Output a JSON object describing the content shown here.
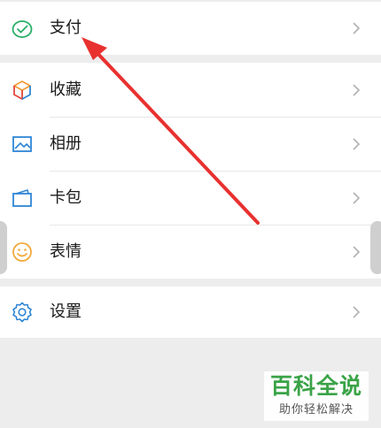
{
  "menu": {
    "pay": {
      "label": "支付",
      "icon": "wechat-pay-icon",
      "color": "#2aae67"
    },
    "items": [
      {
        "label": "收藏",
        "icon": "favorites-cube-icon"
      },
      {
        "label": "相册",
        "icon": "album-picture-icon",
        "color": "#2f86d6"
      },
      {
        "label": "卡包",
        "icon": "card-wallet-icon",
        "color": "#2f86d6"
      },
      {
        "label": "表情",
        "icon": "smiley-emoji-icon",
        "color": "#f2a93b"
      }
    ],
    "settings": {
      "label": "设置",
      "icon": "gear-settings-icon",
      "color": "#2f86d6"
    }
  },
  "watermark": {
    "main": "百科全说",
    "sub": "助你轻松解决",
    "color": "#3aa347"
  },
  "annotation_color": "#e8312f"
}
